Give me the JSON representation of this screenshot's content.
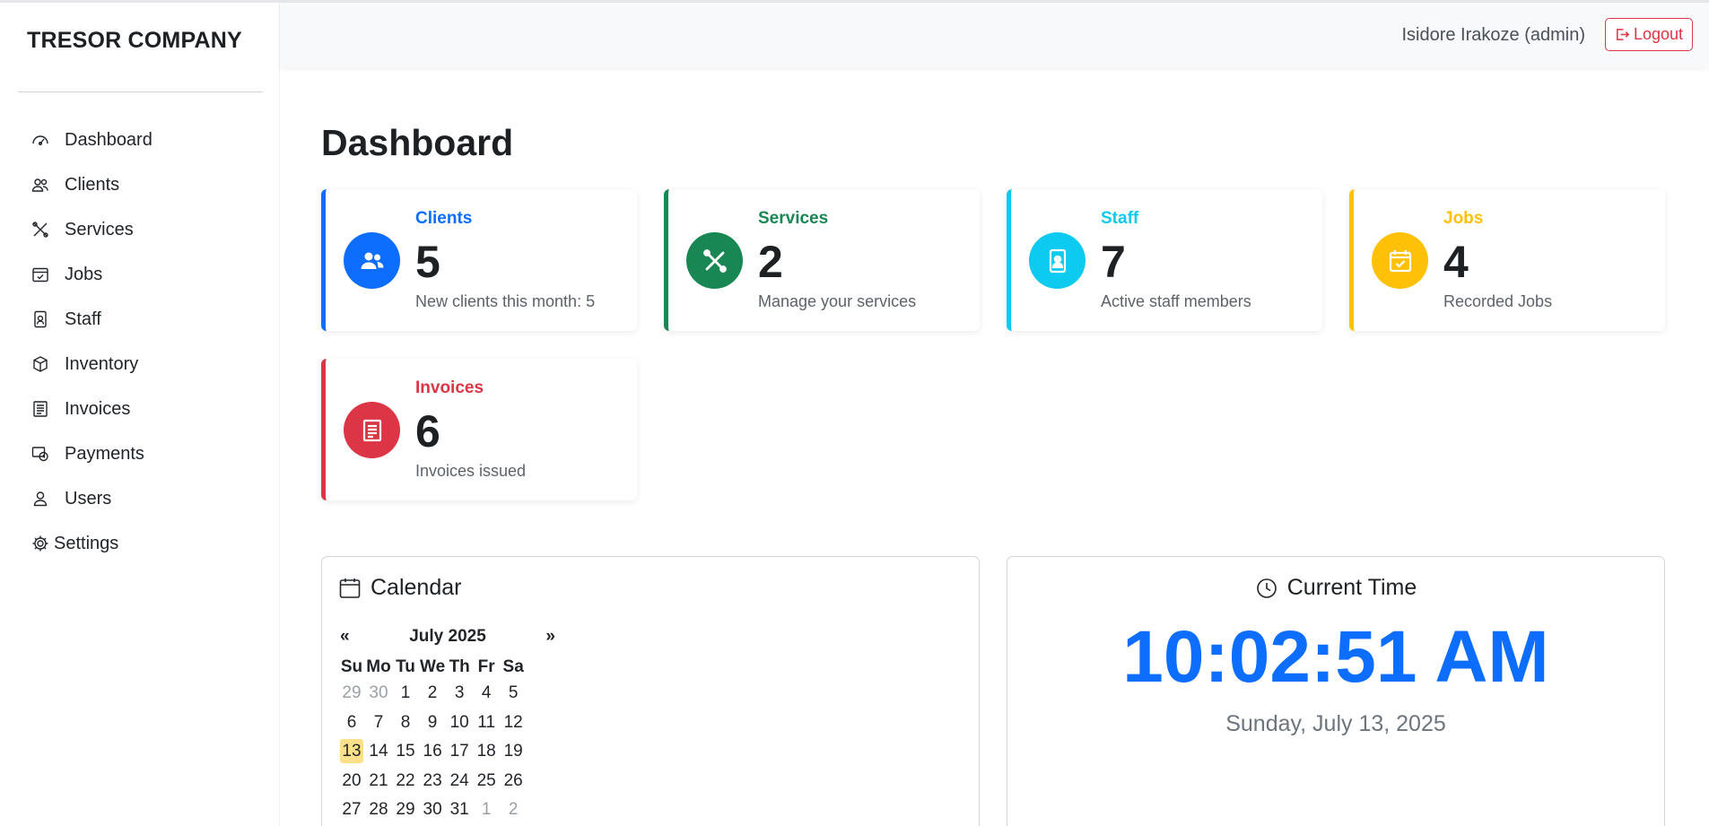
{
  "brand": "TRESOR COMPANY",
  "nav": [
    {
      "label": "Dashboard",
      "icon": "speedometer-icon"
    },
    {
      "label": "Clients",
      "icon": "people-icon"
    },
    {
      "label": "Services",
      "icon": "tools-icon"
    },
    {
      "label": "Jobs",
      "icon": "calendar-check-icon"
    },
    {
      "label": "Staff",
      "icon": "person-badge-icon"
    },
    {
      "label": "Inventory",
      "icon": "box-icon"
    },
    {
      "label": "Invoices",
      "icon": "receipt-icon"
    },
    {
      "label": "Payments",
      "icon": "cash-icon"
    },
    {
      "label": "Users",
      "icon": "person-icon"
    },
    {
      "label": "Settings",
      "icon": "gear-icon"
    }
  ],
  "topbar": {
    "user": "Isidore Irakoze (admin)",
    "logout": "Logout"
  },
  "page_title": "Dashboard",
  "cards": [
    {
      "label": "Clients",
      "value": "5",
      "desc": "New clients this month: 5",
      "color": "#0d6efd",
      "icon": "people-icon"
    },
    {
      "label": "Services",
      "value": "2",
      "desc": "Manage your services",
      "color": "#198754",
      "icon": "tools-icon"
    },
    {
      "label": "Staff",
      "value": "7",
      "desc": "Active staff members",
      "color": "#0dcaf0",
      "icon": "person-badge-icon"
    },
    {
      "label": "Jobs",
      "value": "4",
      "desc": "Recorded Jobs",
      "color": "#ffc107",
      "icon": "calendar-check-icon"
    },
    {
      "label": "Invoices",
      "value": "6",
      "desc": "Invoices issued",
      "color": "#dc3545",
      "icon": "receipt-icon"
    }
  ],
  "calendar": {
    "title": "Calendar",
    "prev": "«",
    "next": "»",
    "month": "July 2025",
    "weekdays": [
      "Su",
      "Mo",
      "Tu",
      "We",
      "Th",
      "Fr",
      "Sa"
    ],
    "weeks": [
      [
        "29",
        "30",
        "1",
        "2",
        "3",
        "4",
        "5"
      ],
      [
        "6",
        "7",
        "8",
        "9",
        "10",
        "11",
        "12"
      ],
      [
        "13",
        "14",
        "15",
        "16",
        "17",
        "18",
        "19"
      ],
      [
        "20",
        "21",
        "22",
        "23",
        "24",
        "25",
        "26"
      ],
      [
        "27",
        "28",
        "29",
        "30",
        "31",
        "1",
        "2"
      ]
    ],
    "today": "13"
  },
  "time_panel": {
    "title": "Current Time",
    "time": "10:02:51 AM",
    "date": "Sunday, July 13, 2025"
  }
}
